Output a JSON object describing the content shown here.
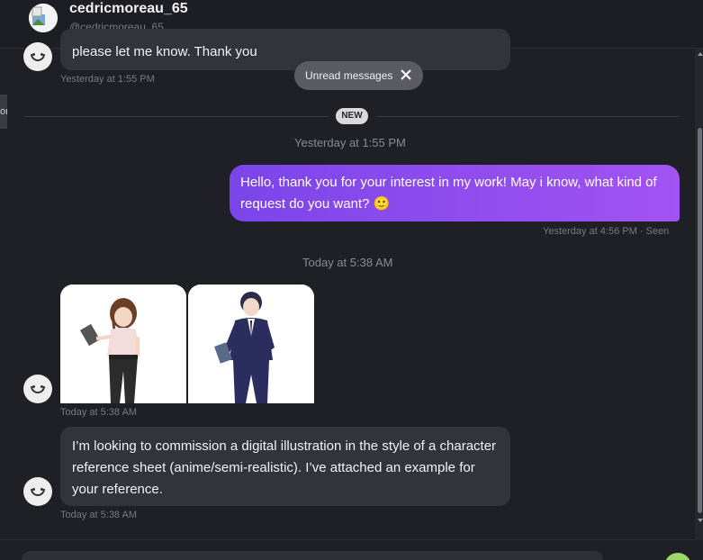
{
  "header": {
    "name": "cedricmoreau_65",
    "handle": "@cedricmoreau_65"
  },
  "edge_tab": {
    "label": "or"
  },
  "unread": {
    "label": "Unread messages"
  },
  "divider": {
    "badge": "NEW"
  },
  "messages": [
    {
      "text": "please let me know. Thank you",
      "time": "Yesterday at 1:55 PM"
    },
    {
      "separator": "Yesterday at 1:55 PM"
    },
    {
      "text": "Hello, thank you for your interest in my work! May i know, what kind of request do you want? 🙂",
      "time": "Yesterday at 4:56 PM · Seen"
    },
    {
      "separator": "Today at 5:38 AM"
    },
    {
      "time": "Today at 5:38 AM"
    },
    {
      "text": "I’m looking to commission a digital illustration in the style of a character reference sheet (anime/semi-realistic). I’ve attached an example for your reference.",
      "time": "Today at 5:38 AM"
    }
  ],
  "colors": {
    "background": "#1f1f26",
    "outgoing_bubble_start": "#7b45ea",
    "outgoing_bubble_end": "#a253f2",
    "incoming_bubble": "#33333c",
    "online_indicator": "#9bd86a"
  },
  "icons": [
    "broken-image-icon",
    "close-icon",
    "smiley-avatar-icon",
    "scroll-up-arrow-icon",
    "scroll-down-arrow-icon"
  ]
}
